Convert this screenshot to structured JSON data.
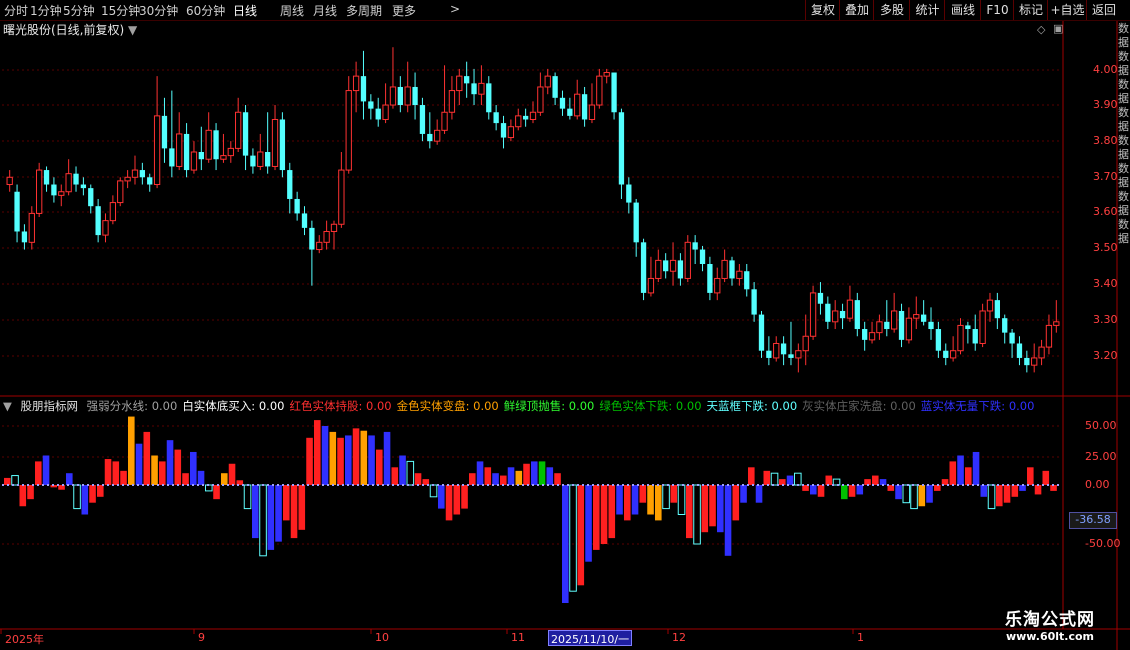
{
  "toolbar": {
    "periods": [
      "分时",
      "1分钟",
      "5分钟",
      "15分钟",
      "30分钟",
      "60分钟",
      "日线",
      "周线",
      "月线",
      "多周期",
      "更多"
    ],
    "active_period": "日线",
    "right_buttons": [
      "复权",
      "叠加",
      "多股",
      "统计",
      "画线",
      "F10",
      "标记",
      "+自选",
      "返回"
    ]
  },
  "main": {
    "title": "曙光股份(日线,前复权)",
    "price_labels": [
      "4.00",
      "3.90",
      "3.80",
      "3.70",
      "3.60",
      "3.50",
      "3.40",
      "3.30",
      "3.20"
    ]
  },
  "indicator": {
    "name": "股朋指标网",
    "items": [
      {
        "label": "强弱分水线: 0.00",
        "color": "#a0a0a0"
      },
      {
        "label": "白实体底买入: 0.00",
        "color": "#ffffff"
      },
      {
        "label": "红色实体持股: 0.00",
        "color": "#ff3030"
      },
      {
        "label": "金色实体变盘: 0.00",
        "color": "#ffa000"
      },
      {
        "label": "鲜绿顶抛售: 0.00",
        "color": "#30ff30"
      },
      {
        "label": "绿色实体下跌: 0.00",
        "color": "#00c000"
      },
      {
        "label": "天蓝框下跌: 0.00",
        "color": "#60ffff"
      },
      {
        "label": "灰实体庄家洗盘: 0.00",
        "color": "#606060"
      },
      {
        "label": "蓝实体无量下跌: 0.00",
        "color": "#3030ff"
      }
    ],
    "axis_labels": [
      "50.00",
      "25.00",
      "0.00",
      "-50.00"
    ],
    "current_value": "-36.58"
  },
  "dates": [
    {
      "label": "2025年"
    },
    {
      "label": "9"
    },
    {
      "label": "10"
    },
    {
      "label": "11"
    },
    {
      "label": "12"
    },
    {
      "label": "1"
    }
  ],
  "date_cursor": "2025/11/10/一",
  "right_strip_text": "数据数据数据数据数据数据数据数据",
  "watermark": {
    "line1": "乐淘公式网",
    "line2": "www.60lt.com"
  },
  "chart_data": {
    "type": "candlestick",
    "price_range": [
      3.15,
      4.08
    ],
    "candles": [
      [
        3.68,
        3.7,
        3.66,
        3.72
      ],
      [
        3.66,
        3.55,
        3.52,
        3.68
      ],
      [
        3.55,
        3.52,
        3.5,
        3.57
      ],
      [
        3.52,
        3.6,
        3.5,
        3.62
      ],
      [
        3.6,
        3.72,
        3.59,
        3.74
      ],
      [
        3.72,
        3.68,
        3.66,
        3.73
      ],
      [
        3.68,
        3.65,
        3.63,
        3.7
      ],
      [
        3.65,
        3.66,
        3.62,
        3.68
      ],
      [
        3.66,
        3.71,
        3.65,
        3.75
      ],
      [
        3.71,
        3.68,
        3.66,
        3.73
      ],
      [
        3.68,
        3.67,
        3.65,
        3.7
      ],
      [
        3.67,
        3.62,
        3.6,
        3.68
      ],
      [
        3.62,
        3.54,
        3.52,
        3.64
      ],
      [
        3.54,
        3.58,
        3.52,
        3.6
      ],
      [
        3.58,
        3.63,
        3.57,
        3.65
      ],
      [
        3.63,
        3.69,
        3.62,
        3.7
      ],
      [
        3.69,
        3.7,
        3.67,
        3.72
      ],
      [
        3.7,
        3.72,
        3.68,
        3.76
      ],
      [
        3.72,
        3.7,
        3.68,
        3.74
      ],
      [
        3.7,
        3.68,
        3.66,
        3.71
      ],
      [
        3.68,
        3.87,
        3.67,
        3.98
      ],
      [
        3.87,
        3.78,
        3.74,
        3.92
      ],
      [
        3.78,
        3.73,
        3.7,
        3.94
      ],
      [
        3.73,
        3.82,
        3.72,
        3.88
      ],
      [
        3.82,
        3.72,
        3.7,
        3.85
      ],
      [
        3.72,
        3.77,
        3.71,
        3.8
      ],
      [
        3.77,
        3.75,
        3.72,
        3.84
      ],
      [
        3.75,
        3.83,
        3.74,
        3.88
      ],
      [
        3.83,
        3.75,
        3.72,
        3.85
      ],
      [
        3.75,
        3.76,
        3.74,
        3.82
      ],
      [
        3.76,
        3.78,
        3.74,
        3.8
      ],
      [
        3.78,
        3.88,
        3.77,
        3.92
      ],
      [
        3.88,
        3.76,
        3.72,
        3.9
      ],
      [
        3.76,
        3.73,
        3.71,
        3.78
      ],
      [
        3.73,
        3.77,
        3.72,
        3.82
      ],
      [
        3.77,
        3.73,
        3.71,
        3.88
      ],
      [
        3.73,
        3.86,
        3.72,
        3.9
      ],
      [
        3.86,
        3.72,
        3.7,
        3.88
      ],
      [
        3.72,
        3.64,
        3.6,
        3.74
      ],
      [
        3.64,
        3.6,
        3.58,
        3.66
      ],
      [
        3.6,
        3.56,
        3.54,
        3.62
      ],
      [
        3.56,
        3.5,
        3.4,
        3.58
      ],
      [
        3.5,
        3.52,
        3.49,
        3.54
      ],
      [
        3.52,
        3.55,
        3.5,
        3.58
      ],
      [
        3.55,
        3.57,
        3.5,
        3.58
      ],
      [
        3.57,
        3.72,
        3.56,
        3.77
      ],
      [
        3.72,
        3.94,
        3.71,
        3.98
      ],
      [
        3.94,
        3.98,
        3.88,
        4.02
      ],
      [
        3.98,
        3.91,
        3.86,
        4.05
      ],
      [
        3.91,
        3.89,
        3.86,
        3.93
      ],
      [
        3.89,
        3.86,
        3.84,
        3.92
      ],
      [
        3.86,
        3.9,
        3.85,
        3.96
      ],
      [
        3.9,
        3.95,
        3.89,
        4.06
      ],
      [
        3.95,
        3.9,
        3.88,
        3.98
      ],
      [
        3.9,
        3.95,
        3.88,
        4.02
      ],
      [
        3.95,
        3.9,
        3.86,
        3.99
      ],
      [
        3.9,
        3.82,
        3.8,
        3.92
      ],
      [
        3.82,
        3.8,
        3.78,
        3.88
      ],
      [
        3.8,
        3.83,
        3.79,
        3.86
      ],
      [
        3.83,
        3.88,
        3.82,
        4.01
      ],
      [
        3.88,
        3.94,
        3.86,
        3.98
      ],
      [
        3.94,
        3.98,
        3.9,
        4.0
      ],
      [
        3.98,
        3.96,
        3.92,
        4.02
      ],
      [
        3.96,
        3.93,
        3.9,
        4.0
      ],
      [
        3.93,
        3.96,
        3.9,
        4.01
      ],
      [
        3.96,
        3.88,
        3.86,
        3.98
      ],
      [
        3.88,
        3.85,
        3.83,
        3.9
      ],
      [
        3.85,
        3.81,
        3.78,
        3.87
      ],
      [
        3.81,
        3.84,
        3.8,
        3.86
      ],
      [
        3.84,
        3.87,
        3.83,
        3.89
      ],
      [
        3.87,
        3.86,
        3.84,
        3.89
      ],
      [
        3.86,
        3.88,
        3.85,
        3.91
      ],
      [
        3.88,
        3.95,
        3.87,
        3.99
      ],
      [
        3.95,
        3.98,
        3.93,
        4.0
      ],
      [
        3.98,
        3.92,
        3.9,
        3.99
      ],
      [
        3.92,
        3.89,
        3.87,
        3.94
      ],
      [
        3.89,
        3.87,
        3.86,
        3.92
      ],
      [
        3.87,
        3.93,
        3.86,
        3.97
      ],
      [
        3.93,
        3.86,
        3.84,
        3.95
      ],
      [
        3.86,
        3.9,
        3.85,
        3.96
      ],
      [
        3.9,
        3.98,
        3.89,
        4.0
      ],
      [
        3.98,
        3.99,
        3.96,
        4.0
      ],
      [
        3.99,
        3.88,
        3.86,
        3.99
      ],
      [
        3.88,
        3.68,
        3.64,
        3.89
      ],
      [
        3.68,
        3.63,
        3.6,
        3.7
      ],
      [
        3.63,
        3.52,
        3.48,
        3.64
      ],
      [
        3.52,
        3.38,
        3.36,
        3.53
      ],
      [
        3.38,
        3.42,
        3.37,
        3.48
      ],
      [
        3.42,
        3.47,
        3.41,
        3.5
      ],
      [
        3.47,
        3.44,
        3.42,
        3.49
      ],
      [
        3.44,
        3.47,
        3.4,
        3.52
      ],
      [
        3.47,
        3.42,
        3.4,
        3.49
      ],
      [
        3.42,
        3.52,
        3.41,
        3.54
      ],
      [
        3.52,
        3.5,
        3.46,
        3.54
      ],
      [
        3.5,
        3.46,
        3.44,
        3.51
      ],
      [
        3.46,
        3.38,
        3.36,
        3.48
      ],
      [
        3.38,
        3.42,
        3.36,
        3.45
      ],
      [
        3.42,
        3.47,
        3.41,
        3.5
      ],
      [
        3.47,
        3.42,
        3.4,
        3.48
      ],
      [
        3.42,
        3.44,
        3.4,
        3.46
      ],
      [
        3.44,
        3.39,
        3.37,
        3.46
      ],
      [
        3.39,
        3.32,
        3.3,
        3.41
      ],
      [
        3.32,
        3.22,
        3.2,
        3.33
      ],
      [
        3.22,
        3.2,
        3.18,
        3.26
      ],
      [
        3.2,
        3.24,
        3.19,
        3.26
      ],
      [
        3.24,
        3.21,
        3.18,
        3.26
      ],
      [
        3.21,
        3.2,
        3.18,
        3.3
      ],
      [
        3.2,
        3.22,
        3.16,
        3.24
      ],
      [
        3.22,
        3.26,
        3.18,
        3.32
      ],
      [
        3.26,
        3.38,
        3.25,
        3.4
      ],
      [
        3.38,
        3.35,
        3.32,
        3.41
      ],
      [
        3.35,
        3.3,
        3.28,
        3.37
      ],
      [
        3.3,
        3.33,
        3.28,
        3.36
      ],
      [
        3.33,
        3.31,
        3.28,
        3.35
      ],
      [
        3.31,
        3.36,
        3.3,
        3.4
      ],
      [
        3.36,
        3.28,
        3.26,
        3.38
      ],
      [
        3.28,
        3.25,
        3.22,
        3.3
      ],
      [
        3.25,
        3.27,
        3.24,
        3.3
      ],
      [
        3.27,
        3.3,
        3.25,
        3.32
      ],
      [
        3.3,
        3.28,
        3.26,
        3.36
      ],
      [
        3.28,
        3.33,
        3.27,
        3.38
      ],
      [
        3.33,
        3.25,
        3.23,
        3.35
      ],
      [
        3.25,
        3.31,
        3.24,
        3.34
      ],
      [
        3.31,
        3.32,
        3.28,
        3.37
      ],
      [
        3.32,
        3.3,
        3.29,
        3.36
      ],
      [
        3.3,
        3.28,
        3.25,
        3.34
      ],
      [
        3.28,
        3.22,
        3.2,
        3.3
      ],
      [
        3.22,
        3.2,
        3.18,
        3.24
      ],
      [
        3.2,
        3.22,
        3.19,
        3.26
      ],
      [
        3.22,
        3.29,
        3.21,
        3.31
      ],
      [
        3.29,
        3.28,
        3.24,
        3.3
      ],
      [
        3.28,
        3.24,
        3.22,
        3.32
      ],
      [
        3.24,
        3.33,
        3.23,
        3.35
      ],
      [
        3.33,
        3.36,
        3.3,
        3.38
      ],
      [
        3.36,
        3.31,
        3.28,
        3.38
      ],
      [
        3.31,
        3.27,
        3.24,
        3.32
      ],
      [
        3.27,
        3.24,
        3.2,
        3.28
      ],
      [
        3.24,
        3.2,
        3.18,
        3.26
      ],
      [
        3.2,
        3.18,
        3.16,
        3.22
      ],
      [
        3.18,
        3.2,
        3.16,
        3.24
      ],
      [
        3.2,
        3.23,
        3.18,
        3.25
      ],
      [
        3.23,
        3.29,
        3.21,
        3.32
      ],
      [
        3.29,
        3.3,
        3.27,
        3.36
      ]
    ],
    "indicator_bars": [
      [
        6,
        "#ff2020"
      ],
      [
        8,
        "#60ffff"
      ],
      [
        -18,
        "#ff2020"
      ],
      [
        -12,
        "#ff2020"
      ],
      [
        20,
        "#ff2020"
      ],
      [
        25,
        "#3030ff"
      ],
      [
        -2,
        "#ff2020"
      ],
      [
        -4,
        "#ff2020"
      ],
      [
        10,
        "#3030ff"
      ],
      [
        -20,
        "#60ffff"
      ],
      [
        -25,
        "#3030ff"
      ],
      [
        -15,
        "#ff2020"
      ],
      [
        -10,
        "#ff2020"
      ],
      [
        22,
        "#ff2020"
      ],
      [
        20,
        "#ff2020"
      ],
      [
        12,
        "#ff2020"
      ],
      [
        58,
        "#ffa000"
      ],
      [
        35,
        "#3030ff"
      ],
      [
        45,
        "#ff2020"
      ],
      [
        25,
        "#ffa000"
      ],
      [
        20,
        "#ff2020"
      ],
      [
        38,
        "#3030ff"
      ],
      [
        30,
        "#ff2020"
      ],
      [
        10,
        "#ff2020"
      ],
      [
        28,
        "#3030ff"
      ],
      [
        12,
        "#3030ff"
      ],
      [
        -5,
        "#60ffff"
      ],
      [
        -12,
        "#ff2020"
      ],
      [
        10,
        "#ffa000"
      ],
      [
        18,
        "#ff2020"
      ],
      [
        4,
        "#ff2020"
      ],
      [
        -20,
        "#60ffff"
      ],
      [
        -45,
        "#3030ff"
      ],
      [
        -60,
        "#60ffff"
      ],
      [
        -55,
        "#3030ff"
      ],
      [
        -48,
        "#3030ff"
      ],
      [
        -30,
        "#ff2020"
      ],
      [
        -45,
        "#ff2020"
      ],
      [
        -38,
        "#ff2020"
      ],
      [
        40,
        "#ff2020"
      ],
      [
        55,
        "#ff2020"
      ],
      [
        50,
        "#3030ff"
      ],
      [
        45,
        "#ffa000"
      ],
      [
        40,
        "#ff2020"
      ],
      [
        42,
        "#3030ff"
      ],
      [
        48,
        "#ff2020"
      ],
      [
        46,
        "#ffa000"
      ],
      [
        42,
        "#3030ff"
      ],
      [
        30,
        "#ff2020"
      ],
      [
        45,
        "#3030ff"
      ],
      [
        15,
        "#ff2020"
      ],
      [
        25,
        "#3030ff"
      ],
      [
        20,
        "#60ffff"
      ],
      [
        10,
        "#ff2020"
      ],
      [
        5,
        "#ff2020"
      ],
      [
        -10,
        "#60ffff"
      ],
      [
        -20,
        "#3030ff"
      ],
      [
        -30,
        "#ff2020"
      ],
      [
        -25,
        "#ff2020"
      ],
      [
        -20,
        "#ff2020"
      ],
      [
        10,
        "#ff2020"
      ],
      [
        20,
        "#3030ff"
      ],
      [
        15,
        "#ff2020"
      ],
      [
        10,
        "#3030ff"
      ],
      [
        8,
        "#ff2020"
      ],
      [
        15,
        "#3030ff"
      ],
      [
        12,
        "#ffa000"
      ],
      [
        18,
        "#ff2020"
      ],
      [
        20,
        "#3030ff"
      ],
      [
        20,
        "#00c000"
      ],
      [
        15,
        "#3030ff"
      ],
      [
        10,
        "#ff2020"
      ],
      [
        -100,
        "#3030ff"
      ],
      [
        -90,
        "#60ffff"
      ],
      [
        -85,
        "#ff2020"
      ],
      [
        -65,
        "#3030ff"
      ],
      [
        -55,
        "#ff2020"
      ],
      [
        -50,
        "#ff2020"
      ],
      [
        -45,
        "#ff2020"
      ],
      [
        -25,
        "#3030ff"
      ],
      [
        -30,
        "#ff2020"
      ],
      [
        -25,
        "#3030ff"
      ],
      [
        -15,
        "#ff2020"
      ],
      [
        -25,
        "#ffa000"
      ],
      [
        -30,
        "#ffa000"
      ],
      [
        -20,
        "#60ffff"
      ],
      [
        -15,
        "#ff2020"
      ],
      [
        -25,
        "#60ffff"
      ],
      [
        -45,
        "#ff2020"
      ],
      [
        -50,
        "#60ffff"
      ],
      [
        -40,
        "#ff2020"
      ],
      [
        -35,
        "#ff2020"
      ],
      [
        -40,
        "#3030ff"
      ],
      [
        -60,
        "#3030ff"
      ],
      [
        -30,
        "#ff2020"
      ],
      [
        -15,
        "#3030ff"
      ],
      [
        15,
        "#ff2020"
      ],
      [
        -15,
        "#3030ff"
      ],
      [
        12,
        "#ff2020"
      ],
      [
        10,
        "#60ffff"
      ],
      [
        5,
        "#ff2020"
      ],
      [
        8,
        "#3030ff"
      ],
      [
        10,
        "#60ffff"
      ],
      [
        -5,
        "#ff2020"
      ],
      [
        -8,
        "#3030ff"
      ],
      [
        -10,
        "#ff2020"
      ],
      [
        8,
        "#ff2020"
      ],
      [
        5,
        "#60ffff"
      ],
      [
        -12,
        "#00c000"
      ],
      [
        -10,
        "#ff2020"
      ],
      [
        -8,
        "#3030ff"
      ],
      [
        5,
        "#ff2020"
      ],
      [
        8,
        "#ff2020"
      ],
      [
        5,
        "#3030ff"
      ],
      [
        -5,
        "#ff2020"
      ],
      [
        -12,
        "#3030ff"
      ],
      [
        -15,
        "#60ffff"
      ],
      [
        -20,
        "#60ffff"
      ],
      [
        -18,
        "#ffa000"
      ],
      [
        -15,
        "#3030ff"
      ],
      [
        -5,
        "#ff2020"
      ],
      [
        5,
        "#ff2020"
      ],
      [
        20,
        "#ff2020"
      ],
      [
        25,
        "#3030ff"
      ],
      [
        15,
        "#ff2020"
      ],
      [
        28,
        "#3030ff"
      ],
      [
        -10,
        "#3030ff"
      ],
      [
        -20,
        "#60ffff"
      ],
      [
        -18,
        "#ff2020"
      ],
      [
        -15,
        "#ff2020"
      ],
      [
        -10,
        "#ff2020"
      ],
      [
        -5,
        "#3030ff"
      ],
      [
        15,
        "#ff2020"
      ],
      [
        -8,
        "#ff2020"
      ],
      [
        12,
        "#ff2020"
      ],
      [
        -5,
        "#ff2020"
      ]
    ]
  }
}
